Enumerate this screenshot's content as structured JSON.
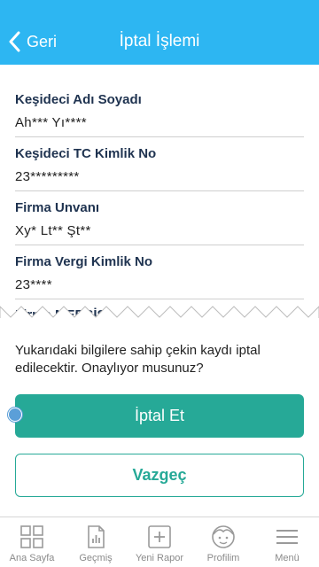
{
  "header": {
    "back_label": "Geri",
    "title": "İptal İşlemi",
    "background_color": "#2db6f2"
  },
  "fields": [
    {
      "label": "Keşideci Adı Soyadı",
      "value": "Ah*** Yı****"
    },
    {
      "label": "Keşideci TC Kimlik No",
      "value": "23*********"
    },
    {
      "label": "Firma Unvanı",
      "value": "Xy* Lt** Şt**"
    },
    {
      "label": "Firma Vergi Kimlik No",
      "value": "23****"
    },
    {
      "label": "Firma MERSİS",
      "value": ""
    }
  ],
  "confirm": {
    "message": "Yukarıdaki bilgilere sahip çekin kaydı iptal edilecektir. Onaylıyor musunuz?",
    "primary_label": "İptal Et",
    "secondary_label": "Vazgeç",
    "accent_color": "#26a997"
  },
  "tabbar": {
    "items": [
      {
        "label": "Ana Sayfa",
        "icon": "grid-icon"
      },
      {
        "label": "Geçmiş",
        "icon": "report-history-icon"
      },
      {
        "label": "Yeni Rapor",
        "icon": "plus-box-icon"
      },
      {
        "label": "Profilim",
        "icon": "face-icon"
      },
      {
        "label": "Menü",
        "icon": "hamburger-menu-icon"
      }
    ]
  }
}
